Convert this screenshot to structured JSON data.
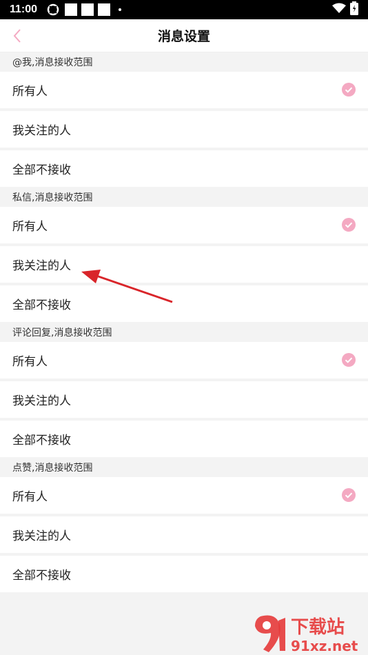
{
  "status_bar": {
    "time": "11:00"
  },
  "nav": {
    "title": "消息设置"
  },
  "sections": [
    {
      "header": "@我,消息接收范围",
      "options": [
        "所有人",
        "我关注的人",
        "全部不接收"
      ],
      "selected": 0
    },
    {
      "header": "私信,消息接收范围",
      "options": [
        "所有人",
        "我关注的人",
        "全部不接收"
      ],
      "selected": 0
    },
    {
      "header": "评论回复,消息接收范围",
      "options": [
        "所有人",
        "我关注的人",
        "全部不接收"
      ],
      "selected": 0
    },
    {
      "header": "点赞,消息接收范围",
      "options": [
        "所有人",
        "我关注的人",
        "全部不接收"
      ],
      "selected": 0
    }
  ],
  "colors": {
    "accent": "#f4a9c2",
    "arrow": "#d9252a"
  },
  "watermark": {
    "text_top": "下载站",
    "text_bottom": "91xz.net"
  }
}
